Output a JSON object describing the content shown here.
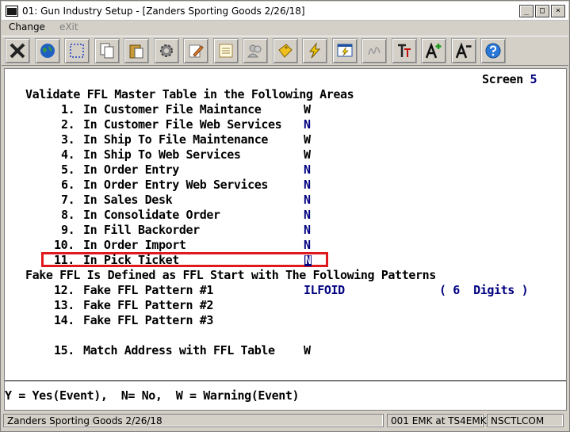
{
  "window": {
    "title": "01: Gun Industry Setup - [Zanders Sporting Goods 2/26/18]",
    "buttons": {
      "minimize": "_",
      "maximize": "□",
      "close": "×"
    }
  },
  "menu": [
    {
      "label": "Change",
      "enabled": true
    },
    {
      "label": "eXit",
      "enabled": false
    }
  ],
  "toolbar": [
    "exit-icon",
    "globe-icon",
    "select-icon",
    "copy-icon",
    "paste-icon",
    "settings-gear-icon",
    "edit-pencil-icon",
    "notes-icon",
    "people-icon",
    "tag-icon",
    "lightning-icon",
    "form-lightning-icon",
    "signature-icon",
    "font-tt-icon",
    "font-increase-icon",
    "font-decrease-icon",
    "help-icon"
  ],
  "screen": {
    "label": "Screen",
    "number": "5",
    "heading": "Validate FFL Master Table in the Following Areas",
    "items": [
      {
        "num": "1.",
        "label": "In Customer File Maintance",
        "value": "W"
      },
      {
        "num": "2.",
        "label": "In Customer File Web Services",
        "value": "N"
      },
      {
        "num": "3.",
        "label": "In Ship To File Maintenance",
        "value": "W"
      },
      {
        "num": "4.",
        "label": "In Ship To Web Services",
        "value": "W"
      },
      {
        "num": "5.",
        "label": "In Order Entry",
        "value": "N"
      },
      {
        "num": "6.",
        "label": "In Order Entry Web Services",
        "value": "N"
      },
      {
        "num": "7.",
        "label": "In Sales Desk",
        "value": "N"
      },
      {
        "num": "8.",
        "label": "In Consolidate Order",
        "value": "N"
      },
      {
        "num": "9.",
        "label": "In Fill Backorder",
        "value": "N"
      },
      {
        "num": "10.",
        "label": "In Order Import",
        "value": "N"
      },
      {
        "num": "11.",
        "label": "In Pick Ticket",
        "value": "N"
      }
    ],
    "fake_heading": "Fake FFL Is Defined as FFL Start with The Following Patterns",
    "patterns": [
      {
        "num": "12.",
        "label": "Fake FFL Pattern #1",
        "value": "ILFOID",
        "note": "( 6  Digits )"
      },
      {
        "num": "13.",
        "label": "Fake FFL Pattern #2",
        "value": "",
        "note": ""
      },
      {
        "num": "14.",
        "label": "Fake FFL Pattern #3",
        "value": "",
        "note": ""
      }
    ],
    "match": {
      "num": "15.",
      "label": "Match Address with FFL Table",
      "value": "W"
    },
    "legend": "Y = Yes(Event),  N= No,  W = Warning(Event)"
  },
  "status": {
    "company": "Zanders Sporting Goods 2/26/18",
    "user": "001 EMK at TS4EMK",
    "system": "NSCTLCOM"
  }
}
